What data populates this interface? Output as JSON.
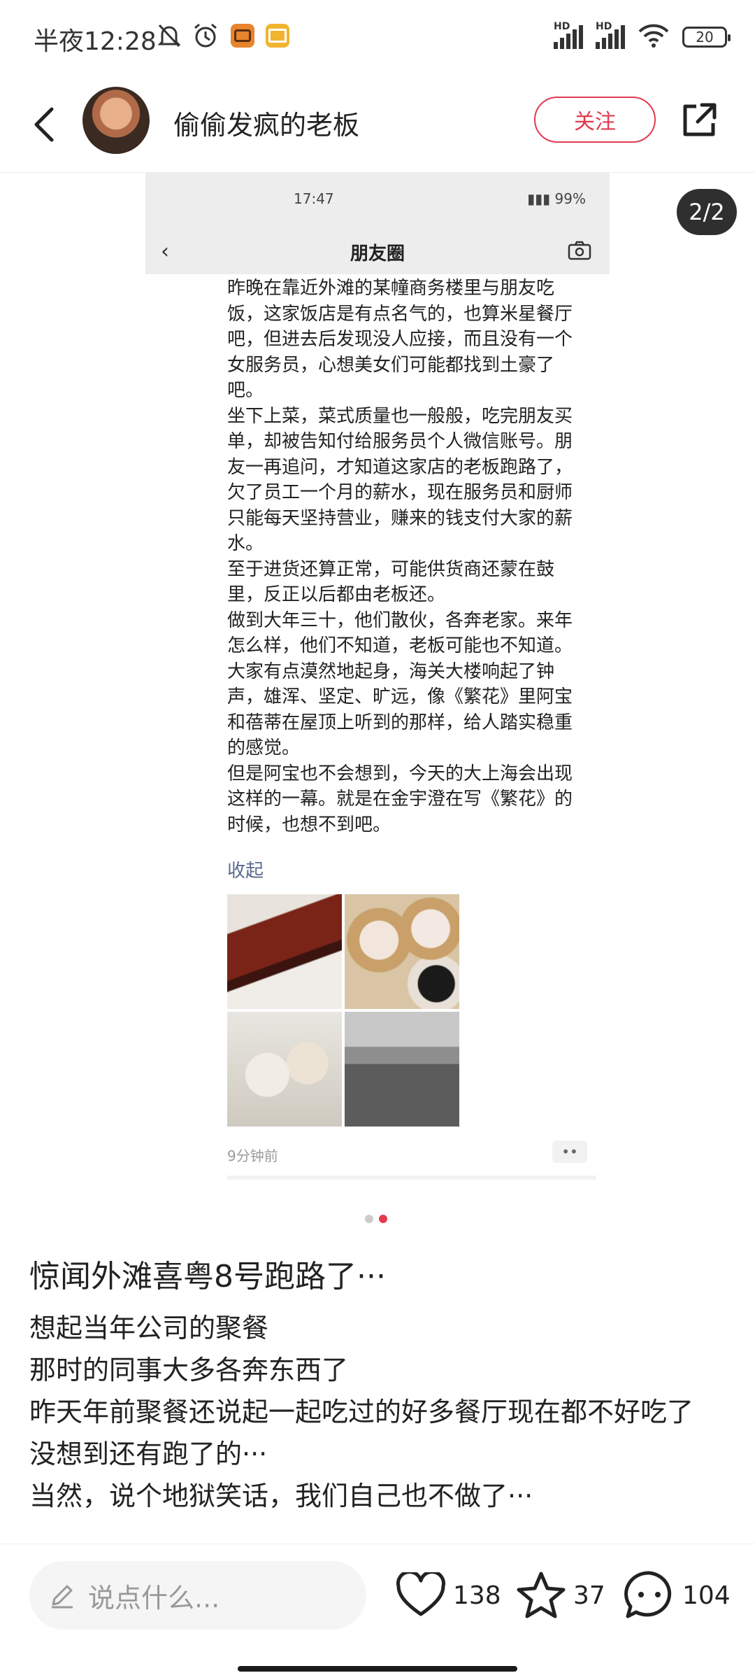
{
  "status_bar": {
    "time": "半夜12:28",
    "battery": "20"
  },
  "header": {
    "username": "偷偷发疯的老板",
    "follow_label": "关注"
  },
  "image_counter": "2/2",
  "screenshot": {
    "status_time": "17:47",
    "battery": "99%",
    "nav_title": "朋友圈",
    "paragraphs": [
      "昨晚在靠近外滩的某幢商务楼里与朋友吃饭，这家饭店是有点名气的，也算米星餐厅吧，但进去后发现没人应接，而且没有一个女服务员，心想美女们可能都找到土豪了吧。",
      "坐下上菜，菜式质量也一般般，吃完朋友买单，却被告知付给服务员个人微信账号。朋友一再追问，才知道这家店的老板跑路了，欠了员工一个月的薪水，现在服务员和厨师只能每天坚持营业，赚来的钱支付大家的薪水。",
      "至于进货还算正常，可能供货商还蒙在鼓里，反正以后都由老板还。",
      "做到大年三十，他们散伙，各奔老家。来年怎么样，他们不知道，老板可能也不知道。",
      "大家有点漠然地起身，海关大楼响起了钟声，雄浑、坚定、旷远，像《繁花》里阿宝和蓓蒂在屋顶上听到的那样，给人踏实稳重的感觉。",
      "但是阿宝也不会想到，今天的大上海会出现这样的一幕。就是在金宇澄在写《繁花》的时候，也想不到吧。"
    ],
    "collapse_label": "收起",
    "time_ago": "9分钟前"
  },
  "post": {
    "title": "惊闻外滩喜粤8号跑路了···",
    "lines": [
      "想起当年公司的聚餐",
      "那时的同事大多各奔东西了",
      "昨天年前聚餐还说起一起吃过的好多餐厅现在都不好吃了",
      "没想到还有跑了的···",
      "当然，说个地狱笑话，我们自己也不做了···"
    ]
  },
  "bottom_bar": {
    "comment_placeholder": "说点什么...",
    "likes": "138",
    "favorites": "37",
    "comments": "104"
  },
  "carousel": {
    "total": 2,
    "active": 2
  },
  "colors": {
    "accent": "#e23a4e"
  }
}
